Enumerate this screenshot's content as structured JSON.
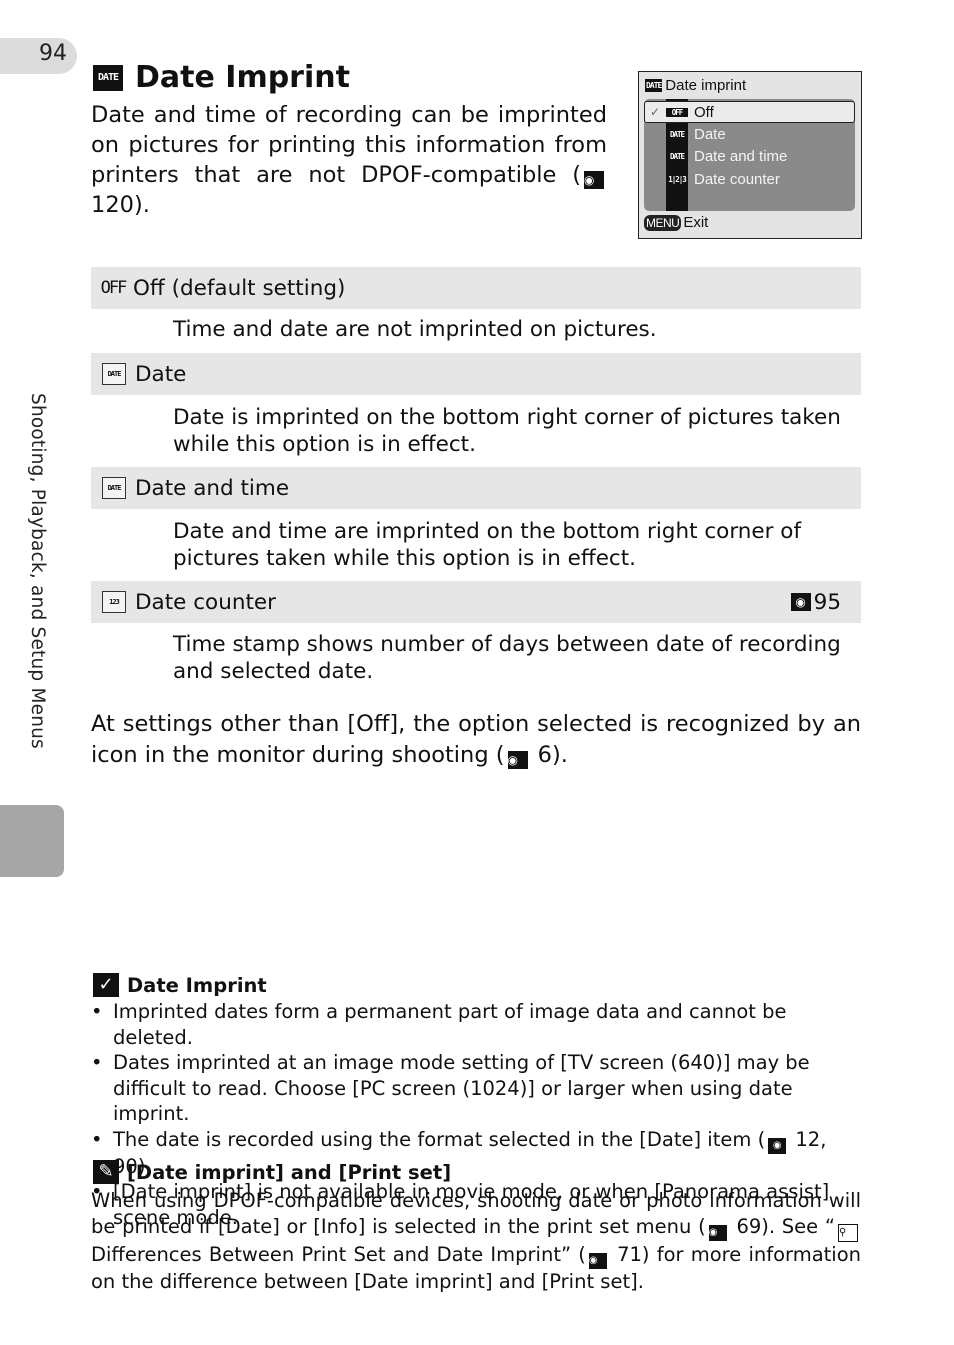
{
  "page": {
    "number": "94",
    "section_label": "Shooting, Playback, and Setup Menus"
  },
  "header": {
    "icon": "DATE",
    "title": "Date Imprint"
  },
  "intro": {
    "text_before_ref": "Date and time of recording can be imprinted on pictures for printing this information from printers that are not DPOF-compatible (",
    "ref_icon": "👁",
    "ref_page": " 120)."
  },
  "camera_screen": {
    "title_icon": "DATE",
    "title": "Date imprint",
    "items": [
      {
        "icon": "OFF",
        "label": "Off",
        "selected": true,
        "check": "✓"
      },
      {
        "icon": "DATE",
        "label": "Date",
        "selected": false
      },
      {
        "icon": "DATE",
        "label": "Date and time",
        "selected": false
      },
      {
        "icon": "1|2|3",
        "label": "Date counter",
        "selected": false
      }
    ],
    "footer_button": "MENU",
    "footer_label": "Exit"
  },
  "options": [
    {
      "icon": "OFF",
      "label": "Off (default setting)",
      "description": "Time and date are not imprinted on pictures."
    },
    {
      "icon": "DATE",
      "label": "Date",
      "description": "Date is imprinted on the bottom right corner of pictures taken while this option is in effect."
    },
    {
      "icon": "DATE",
      "label": "Date and time",
      "description": "Date and time are imprinted on the bottom right corner of pictures taken while this option is in effect."
    },
    {
      "icon": "123",
      "label": "Date counter",
      "ref_icon": "👁",
      "ref_page": "95",
      "description": "Time stamp shows number of days between date of recording and selected date."
    }
  ],
  "settings_note": {
    "text_before_ref": "At settings other than [Off], the option selected is recognized by an icon in the monitor during shooting (",
    "ref_icon": "👁",
    "ref_after": " 6)."
  },
  "caution": {
    "icon": "✓",
    "title": "Date Imprint",
    "bullets": [
      {
        "text": "Imprinted dates form a permanent part of image data and cannot be deleted."
      },
      {
        "text": "Dates imprinted at an image mode setting of [TV screen (640)] may be difficult to read. Choose [PC screen (1024)] or larger when using date imprint."
      },
      {
        "text_before_ref": "The date is recorded using the format selected in the [Date] item (",
        "ref_icon": "👁",
        "ref_after": " 12, 90)."
      },
      {
        "text": "[Date imprint] is not available in movie mode, or when [Panorama assist] scene mode."
      }
    ]
  },
  "tip": {
    "icon": "✎",
    "title": "[Date imprint] and [Print set]",
    "part1": "When using DPOF-compatible devices, shooting date or photo information will be printed if [Date] or [Info] is selected in the print set menu (",
    "ref1_icon": "👁",
    "part2": " 69). See “",
    "magnifier_icon": "🔍",
    "part3": " Differences Between Print Set and Date Imprint” (",
    "ref2_icon": "👁",
    "part4": " 71) for more information on the difference between [Date imprint] and [Print set]."
  }
}
